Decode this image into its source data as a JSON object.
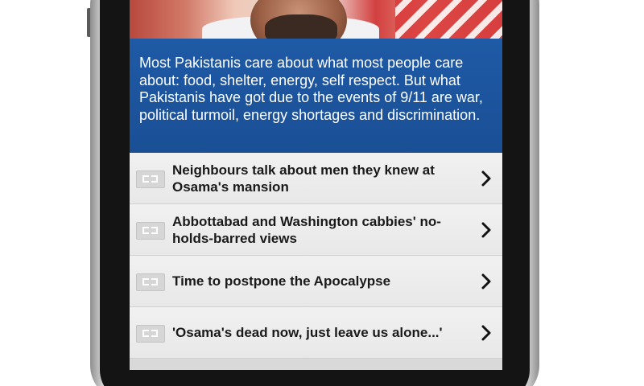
{
  "caption": {
    "text": "Most Pakistanis care about what most people care about: food, shelter, energy, self respect. But what Pakistanis have got due to the events of 9/11 are war, political turmoil, energy shortages and discrimination."
  },
  "stories": [
    {
      "title": "Neighbours talk about men they knew at Osama's mansion",
      "icon": "image-placeholder-icon"
    },
    {
      "title": "Abbottabad and Washington cabbies' no-holds-barred views",
      "icon": "image-placeholder-icon"
    },
    {
      "title": "Time to postpone the Apocalypse",
      "icon": "image-placeholder-icon"
    },
    {
      "title": "'Osama's dead now, just leave us alone...'",
      "icon": "image-placeholder-icon"
    }
  ],
  "colors": {
    "caption_background": "#1f5aa6",
    "list_background": "#eeeeee",
    "phone_frame": "#1f1f1f"
  }
}
